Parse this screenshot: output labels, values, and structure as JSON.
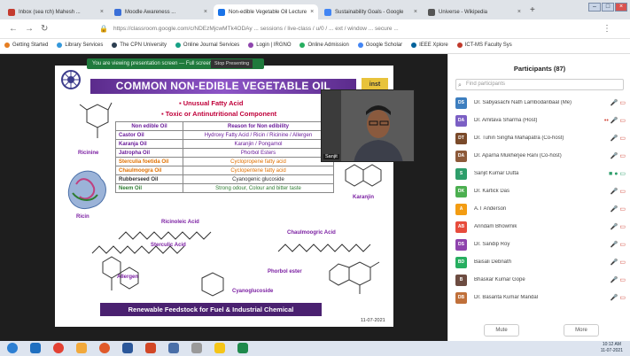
{
  "browser": {
    "tabs": [
      {
        "label": "Inbox (sea rch) Mahesh ...",
        "color": "#c43b2f"
      },
      {
        "label": "Moodle Awareness ...",
        "color": "#3a6fd8"
      },
      {
        "label": "Non-edible Vegetable Oil Lecture",
        "color": "#1a73e8"
      },
      {
        "label": "Sustainability Goals - Google",
        "color": "#4285f4"
      },
      {
        "label": "Universe - Wikipedia",
        "color": "#555555"
      }
    ],
    "new_tab": "+",
    "url": "https://classroom.google.com/c/NDEzMjcwMTk4ODAy ... sessions / live-class / u/0 / ... ext / window ... secure ...",
    "bookmarks": [
      "Getting Started",
      "Library Services",
      "The CPN University",
      "Online Journal Services",
      "Login | IRGNO",
      "Online Admission",
      "Google Scholar",
      "IEEE Xplore",
      "ICT-MS Faculty Sys"
    ]
  },
  "meeting": {
    "recording_bar": "You are viewing presentation screen — Full screen",
    "presenting_label": "Stop Presenting",
    "camera_name": "Sanjit",
    "slide": {
      "title": "COMMON NON-EDIBLE VEGETABLE OIL",
      "bullet1": "Unusual Fatty Acid",
      "bullet2": "Toxic or Antinutritional Component",
      "table_headers": [
        "Non edible Oil",
        "Reason for Non edibility"
      ],
      "rows": [
        {
          "oil": "Castor Oil",
          "reason": "Hydroxy Fatty Acid / Ricin / Ricinine / Allergen",
          "color": "#6a1b9a"
        },
        {
          "oil": "Karanja Oil",
          "reason": "Karanjin / Pongamol",
          "color": "#6a1b9a"
        },
        {
          "oil": "Jatropha Oil",
          "reason": "Phorbol Esters",
          "color": "#6a1b9a"
        },
        {
          "oil": "Sterculia foetida Oil",
          "reason": "Cyclopropene fatty acid",
          "color": "#e07000"
        },
        {
          "oil": "Chaulmoogra Oil",
          "reason": "Cyclopentene fatty acid",
          "color": "#e07000"
        },
        {
          "oil": "Rubberseed Oil",
          "reason": "Cyanogenic glucoside",
          "color": "#333333"
        },
        {
          "oil": "Neem Oil",
          "reason": "Strong odour, Colour and bitter taste",
          "color": "#2e7d32"
        }
      ],
      "labels": {
        "ricinine": "Ricinine",
        "karanjin": "Karanjin",
        "ricin": "Ricin",
        "ricinoleic": "Ricinoleic Acid",
        "sterculic": "Sterculic Acid",
        "chaulmoogric": "Chaulmoogric Acid",
        "allergen": "Allergen",
        "phorbol": "Phorbol ester",
        "cyanoglucoside": "Cyanoglucoside"
      },
      "banner": "Renewable Feedstock for Fuel & Industrial Chemical",
      "date": "11-07-2021"
    }
  },
  "participants": {
    "title": "Participants (87)",
    "search_placeholder": "Find participants",
    "list": [
      {
        "name": "Dr. Sabyasachi Nath Lambodaribaal (Me)",
        "color": "#3d7ebf",
        "initials": "DS"
      },
      {
        "name": "Dr. Amitava Sharma (Host)",
        "color": "#7b5fc4",
        "initials": "DA"
      },
      {
        "name": "Dr. Tuhin Singha Mahapatra (Co-host)",
        "color": "#7a4a2a",
        "initials": "DT"
      },
      {
        "name": "Dr. Aparna Mukherjee Rani (Co-host)",
        "color": "#8d5a3a",
        "initials": "DA"
      },
      {
        "name": "Sanjit Kumar Dutta",
        "color": "#2e9e6b",
        "initials": "S"
      },
      {
        "name": "Dr. Kartick Das",
        "color": "#4caf50",
        "initials": "DK"
      },
      {
        "name": "A.T Anderson",
        "color": "#f39c12",
        "initials": "A"
      },
      {
        "name": "Arindam Bhowmik",
        "color": "#e74c3c",
        "initials": "AB"
      },
      {
        "name": "Dr. Sandip Roy",
        "color": "#8e44ad",
        "initials": "DS"
      },
      {
        "name": "Baisali Debnath",
        "color": "#27ae60",
        "initials": "BD"
      },
      {
        "name": "Bhaskar Kumar Gope",
        "color": "#6d4c41",
        "initials": "B"
      },
      {
        "name": "Dr. Basanta Kumar Mandal",
        "color": "#c0703a",
        "initials": "DB"
      }
    ],
    "mute_all": "Mute",
    "more": "More"
  },
  "taskbar": {
    "time": "10:12 AM",
    "date": "11-07-2021"
  }
}
